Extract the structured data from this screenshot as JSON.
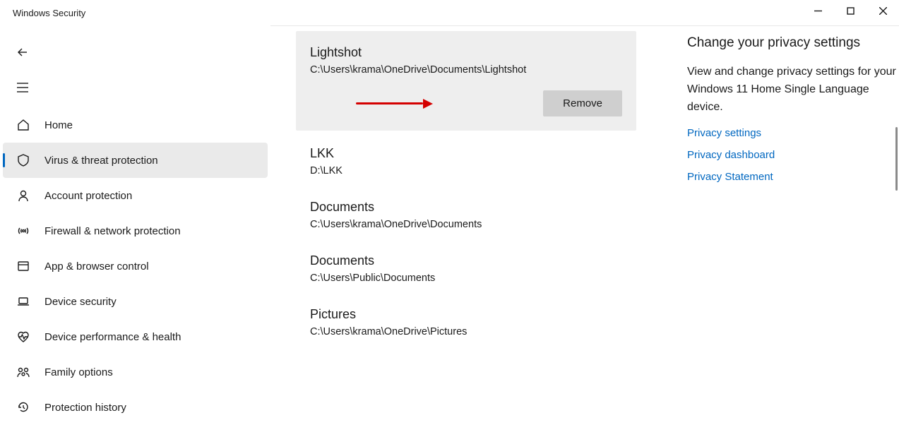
{
  "titlebar": {
    "title": "Windows Security"
  },
  "nav": {
    "items": [
      {
        "label": "Home"
      },
      {
        "label": "Virus & threat protection"
      },
      {
        "label": "Account protection"
      },
      {
        "label": "Firewall & network protection"
      },
      {
        "label": "App & browser control"
      },
      {
        "label": "Device security"
      },
      {
        "label": "Device performance & health"
      },
      {
        "label": "Family options"
      },
      {
        "label": "Protection history"
      }
    ],
    "active_index": 1
  },
  "exclusions": [
    {
      "title": "Lightshot",
      "path": "C:\\Users\\krama\\OneDrive\\Documents\\Lightshot",
      "selected": true,
      "remove_label": "Remove"
    },
    {
      "title": "LKK",
      "path": "D:\\LKK"
    },
    {
      "title": "Documents",
      "path": "C:\\Users\\krama\\OneDrive\\Documents"
    },
    {
      "title": "Documents",
      "path": "C:\\Users\\Public\\Documents"
    },
    {
      "title": "Pictures",
      "path": "C:\\Users\\krama\\OneDrive\\Pictures"
    }
  ],
  "side_panel": {
    "title": "Change your privacy settings",
    "text": "View and change privacy settings for your Windows 11 Home Single Language device.",
    "links": [
      "Privacy settings",
      "Privacy dashboard",
      "Privacy Statement"
    ]
  }
}
